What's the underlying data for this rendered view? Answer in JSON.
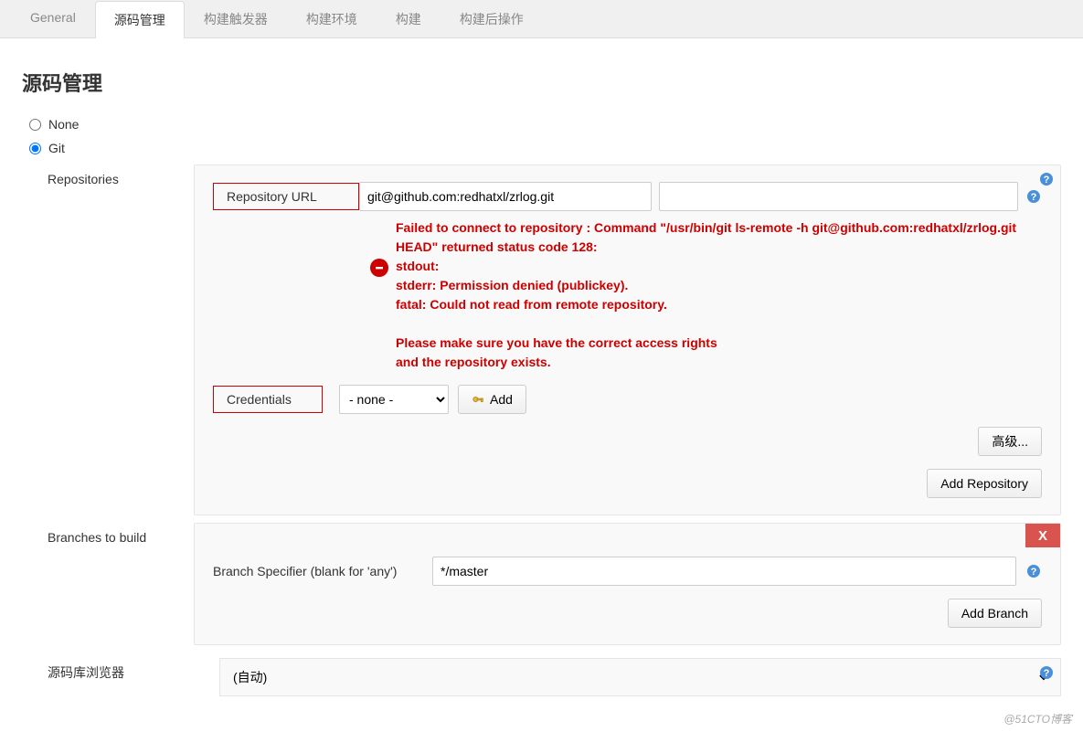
{
  "tabs": {
    "general": "General",
    "scm": "源码管理",
    "triggers": "构建触发器",
    "env": "构建环境",
    "build": "构建",
    "post": "构建后操作"
  },
  "section": {
    "title": "源码管理"
  },
  "scm": {
    "none_label": "None",
    "git_label": "Git"
  },
  "repos": {
    "group_label": "Repositories",
    "url_label": "Repository URL",
    "url_value": "git@github.com:redhatxl/zrlog.git",
    "error": "Failed to connect to repository : Command \"/usr/bin/git ls-remote -h git@github.com:redhatxl/zrlog.git HEAD\" returned status code 128:\nstdout:\nstderr: Permission denied (publickey).\nfatal: Could not read from remote repository.\n\nPlease make sure you have the correct access rights\nand the repository exists.",
    "cred_label": "Credentials",
    "cred_value": "- none -",
    "add_label": "Add",
    "advanced_label": "高级...",
    "add_repo_label": "Add Repository"
  },
  "branches": {
    "group_label": "Branches to build",
    "specifier_label": "Branch Specifier (blank for 'any')",
    "specifier_value": "*/master",
    "add_branch_label": "Add Branch",
    "delete_label": "X"
  },
  "browser": {
    "label": "源码库浏览器",
    "value": "(自动)"
  },
  "watermark": "@51CTO博客"
}
